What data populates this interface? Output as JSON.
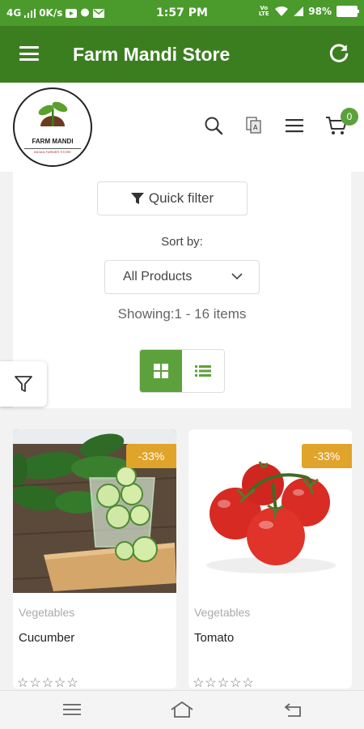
{
  "status_bar": {
    "network": "4G",
    "speed": "0K/s",
    "time": "1:57 PM",
    "volte": "Vo LTE",
    "battery": "98%"
  },
  "app_bar": {
    "title": "Farm Mandi Store",
    "menu_icon": "hamburger-icon",
    "refresh_icon": "refresh-icon"
  },
  "store_header": {
    "logo_text": "FARM MANDI",
    "logo_subtext": "INDIAN FARMER STORE",
    "icons": [
      "search-icon",
      "translate-icon",
      "menu-icon",
      "cart-icon"
    ],
    "cart_count": "0"
  },
  "filter": {
    "quick_filter_label": "Quick filter",
    "sort_label": "Sort by:",
    "sort_value": "All Products",
    "showing_text": "Showing:1 - 16 items",
    "view_mode": "grid"
  },
  "products": [
    {
      "category": "Vegetables",
      "name": "Cucumber",
      "discount": "-33%",
      "rating": 0,
      "rating_max": 5
    },
    {
      "category": "Vegetables",
      "name": "Tomato",
      "discount": "-33%",
      "rating": 0,
      "rating_max": 5
    }
  ],
  "colors": {
    "status_bar": "#4a9a2c",
    "app_bar": "#3b7e20",
    "accent": "#5ca13c",
    "discount_badge": "#e0a42b"
  }
}
